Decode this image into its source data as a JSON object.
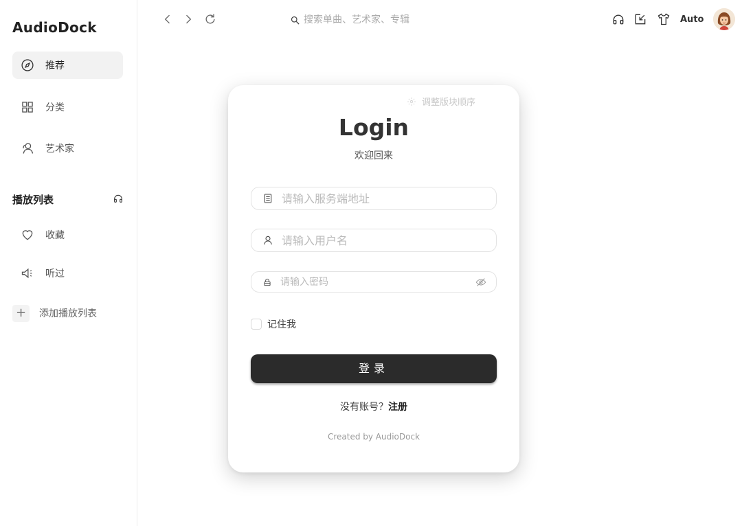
{
  "sidebar": {
    "brand": "AudioDock",
    "nav": [
      {
        "label": "推荐",
        "icon": "compass-icon"
      },
      {
        "label": "分类",
        "icon": "grid-icon"
      },
      {
        "label": "艺术家",
        "icon": "artist-icon"
      }
    ],
    "playlist_section": {
      "title": "播放列表",
      "icon": "headphones-icon"
    },
    "playlists": [
      {
        "label": "收藏",
        "icon": "heart-icon"
      },
      {
        "label": "听过",
        "icon": "speaker-icon"
      }
    ],
    "add_playlist": {
      "icon_glyph": "+",
      "label": "添加播放列表"
    }
  },
  "topbar": {
    "search_placeholder": "搜索单曲、艺术家、专辑",
    "theme_label": "Auto"
  },
  "login": {
    "adjust_label": "调整版块顺序",
    "title": "Login",
    "subtitle": "欢迎回来",
    "server_placeholder": "请输入服务端地址",
    "username_placeholder": "请输入用户名",
    "password_placeholder": "请输入密码",
    "remember_label": "记住我",
    "submit_label": "登录",
    "no_account_text": "没有账号？",
    "register_link": "注册",
    "footer": "Created by AudioDock"
  }
}
